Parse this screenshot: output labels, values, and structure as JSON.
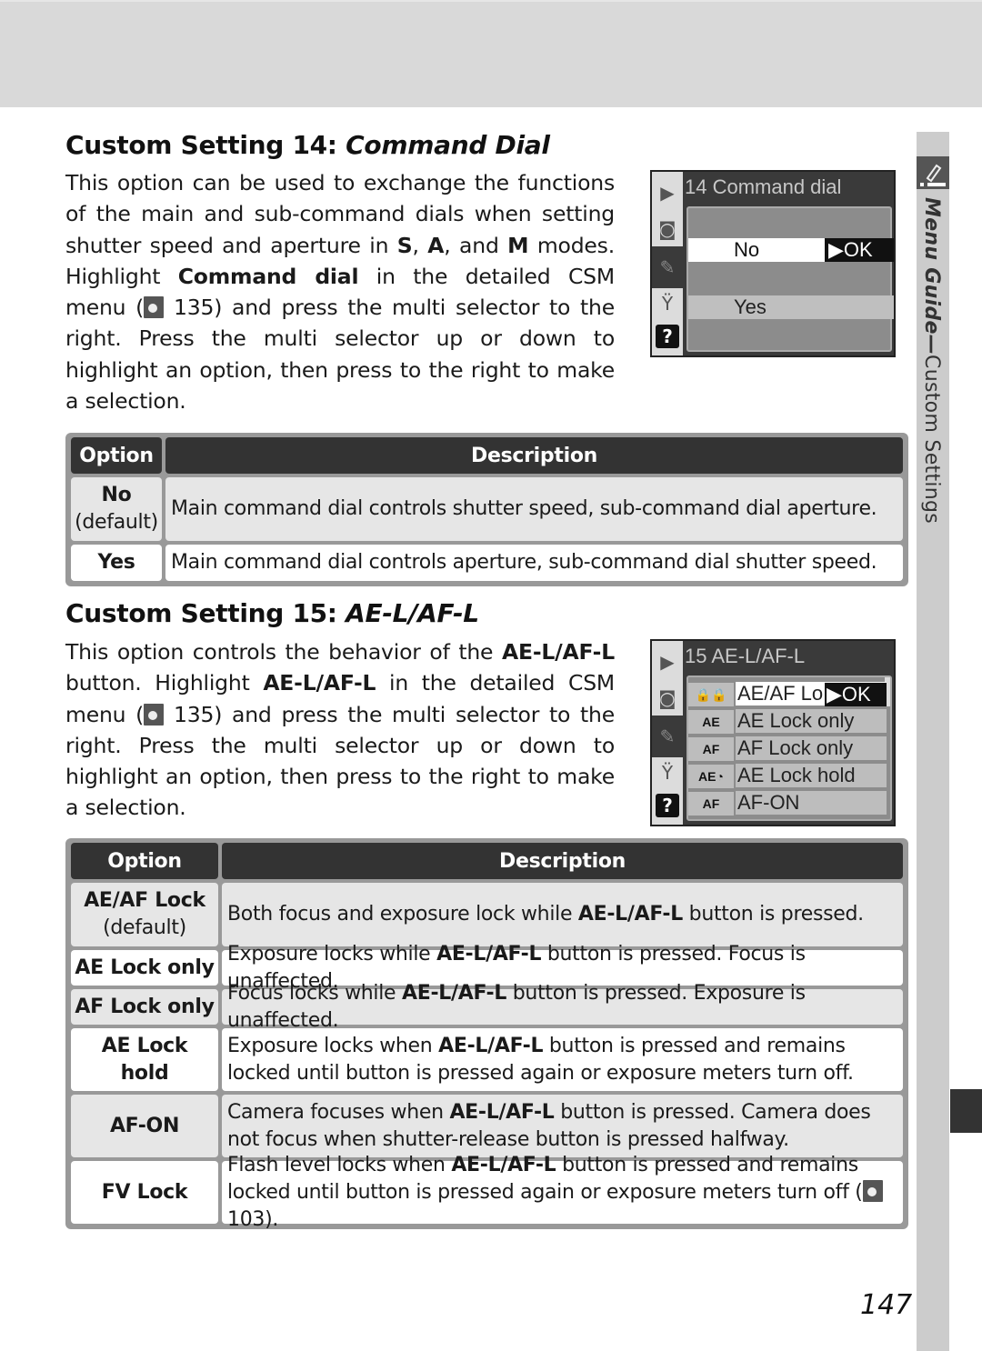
{
  "side_tab": {
    "section": "Menu Guide",
    "dash": "—",
    "subsection": "Custom Settings",
    "icon": "pencil-icon"
  },
  "cs14": {
    "heading_prefix": "Custom Setting 14: ",
    "heading_italic": "Command Dial",
    "para": [
      {
        "t": "This option can be used to exchange the functions of the main and sub-command dials when setting shutter speed and aperture in "
      },
      {
        "b": "S"
      },
      {
        "t": ", "
      },
      {
        "b": "A"
      },
      {
        "t": ", and "
      },
      {
        "b": "M"
      },
      {
        "t": " modes.  Highlight "
      },
      {
        "b": "Command dial"
      },
      {
        "t": " in the detailed CSM menu ("
      },
      {
        "icon": "reference-icon"
      },
      {
        "t": " 135) and press the multi selector to the right.  Press the multi selector up or down to highlight an option, then press to the right to make a selection."
      }
    ],
    "screen": {
      "title": "14 Command dial",
      "options": [
        "No",
        "Yes"
      ],
      "selected": "No",
      "ok_label": "▶OK",
      "menu_icons": [
        "playback-icon",
        "camera-icon",
        "pencil-icon",
        "wrench-icon",
        "help-icon"
      ]
    },
    "table": {
      "headers": [
        "Option",
        "Description"
      ],
      "rows": [
        {
          "option": "No",
          "sub": "(default)",
          "desc": "Main command dial controls shutter speed, sub-command dial aperture."
        },
        {
          "option": "Yes",
          "sub": "",
          "desc": "Main command dial controls aperture, sub-command dial shutter speed."
        }
      ]
    }
  },
  "cs15": {
    "heading_prefix": "Custom Setting 15: ",
    "heading_italic": "AE-L/AF-L",
    "para": [
      {
        "t": "This option controls the behavior of the "
      },
      {
        "b": "AE-L/AF-L"
      },
      {
        "t": " button.  Highlight "
      },
      {
        "b": "AE-L/AF-L"
      },
      {
        "t": " in the detailed CSM menu ("
      },
      {
        "icon": "reference-icon"
      },
      {
        "t": " 135) and press the multi selector to the right.  Press the multi selector up or down to highlight an option, then press to the right to make a selection."
      }
    ],
    "screen": {
      "title": "15 AE-L/AF-L",
      "ok_label": "▶OK",
      "options": [
        {
          "icon": "double-lock-icon",
          "glyph": "🔒🔒",
          "label": "AE/AF Lo"
        },
        {
          "icon": "ae-lock-icon",
          "glyph": "AE",
          "label": "AE Lock only"
        },
        {
          "icon": "af-lock-icon",
          "glyph": "AF",
          "label": "AF Lock only"
        },
        {
          "icon": "ae-lock-hold-icon",
          "glyph": "AE◔",
          "label": "AE Lock hold"
        },
        {
          "icon": "af-on-icon",
          "glyph": "AF",
          "label": "AF-ON"
        }
      ],
      "selected": "AE/AF Lock"
    },
    "table": {
      "headers": [
        "Option",
        "Description"
      ],
      "rows": [
        {
          "option": "AE/AF Lock",
          "sub": "(default)",
          "desc_parts": [
            {
              "t": "Both focus and exposure lock while "
            },
            {
              "b": "AE-L/AF-L"
            },
            {
              "t": " button is pressed."
            }
          ]
        },
        {
          "option": "AE Lock only",
          "sub": "",
          "desc_parts": [
            {
              "t": "Exposure locks while "
            },
            {
              "b": "AE-L/AF-L"
            },
            {
              "t": " button is pressed.  Focus is unaffected."
            }
          ]
        },
        {
          "option": "AF Lock only",
          "sub": "",
          "desc_parts": [
            {
              "t": "Focus locks while "
            },
            {
              "b": "AE-L/AF-L"
            },
            {
              "t": " button is pressed.  Exposure is unaffected."
            }
          ]
        },
        {
          "option": "AE Lock hold",
          "sub": "",
          "desc_parts": [
            {
              "t": "Exposure locks when "
            },
            {
              "b": "AE-L/AF-L"
            },
            {
              "t": " button is pressed and remains locked until button is pressed again or exposure meters turn off."
            }
          ]
        },
        {
          "option": "AF-ON",
          "sub": "",
          "desc_parts": [
            {
              "t": "Camera focuses when "
            },
            {
              "b": "AE-L/AF-L"
            },
            {
              "t": " button is pressed.  Camera does not focus when shutter-release button is pressed halfway."
            }
          ]
        },
        {
          "option": "FV Lock",
          "sub": "",
          "desc_parts": [
            {
              "t": "Flash level locks when "
            },
            {
              "b": "AE-L/AF-L"
            },
            {
              "t": " button is pressed and remains locked until button is pressed again or exposure meters turn off ("
            },
            {
              "icon": "reference-icon"
            },
            {
              "t": " 103)."
            }
          ]
        }
      ]
    }
  },
  "page_number": "147"
}
